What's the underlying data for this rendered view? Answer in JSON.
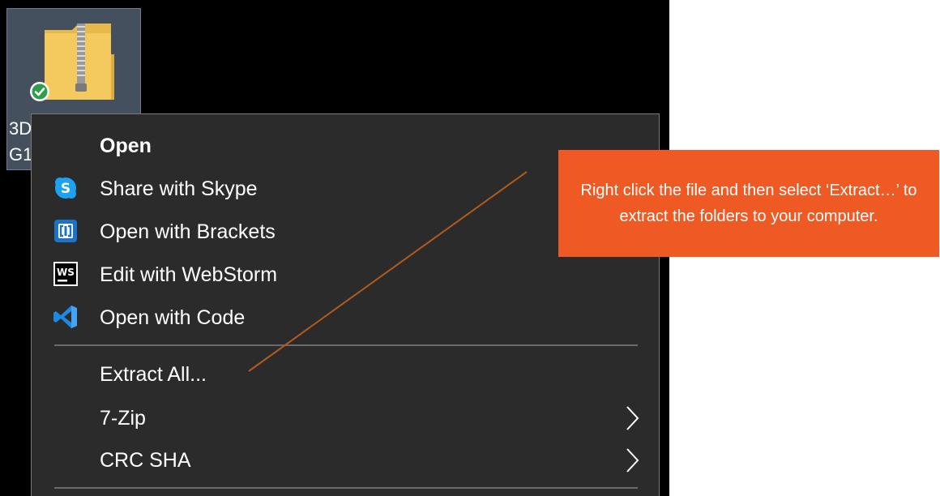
{
  "desktop": {
    "file_label_line1": "3D",
    "file_label_line2": "G1"
  },
  "context_menu": {
    "items": [
      {
        "label": "Open",
        "icon": "none",
        "bold": true
      },
      {
        "label": "Share with Skype",
        "icon": "skype-icon"
      },
      {
        "label": "Open with Brackets",
        "icon": "brackets-icon"
      },
      {
        "label": "Edit with WebStorm",
        "icon": "webstorm-icon"
      },
      {
        "label": "Open with Code",
        "icon": "vscode-icon"
      },
      {
        "label": "Extract All...",
        "icon": "none"
      },
      {
        "label": "7-Zip",
        "icon": "none",
        "submenu": true
      },
      {
        "label": "CRC SHA",
        "icon": "none",
        "submenu": true
      }
    ],
    "webstorm_badge": "WS",
    "skype_badge": "S"
  },
  "callout": {
    "text": "Right click the file and then select ‘Extract…’ to extract the folders to your computer."
  },
  "colors": {
    "menu_bg": "#2b2b2b",
    "callout_bg": "#ef5a24",
    "pointer_line": "#b05a1e",
    "selection_tile": "#44505e",
    "folder_yellow": "#f4c95d"
  }
}
